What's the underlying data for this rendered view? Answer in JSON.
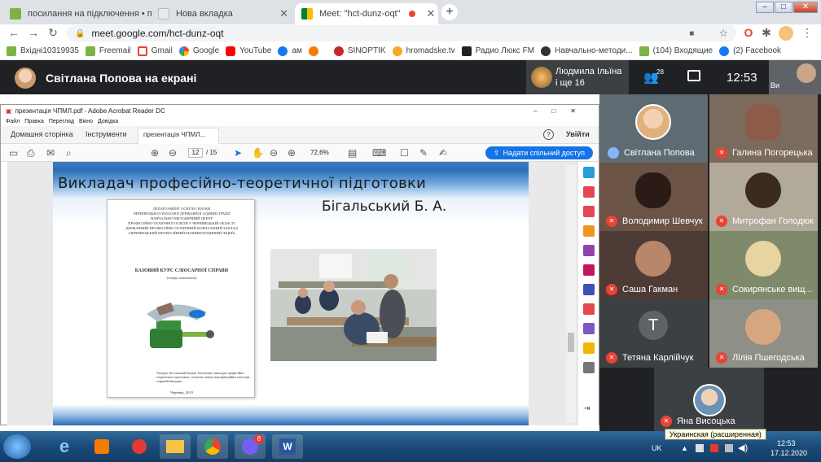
{
  "browser": {
    "tabs": [
      {
        "title": "посилання на підключення • по",
        "close": "✕"
      },
      {
        "title": "Нова вкладка",
        "close": "✕"
      },
      {
        "title": "Meet: \"hct-dunz-oqt\"",
        "close": "✕"
      }
    ],
    "new_tab": "+",
    "url": "meet.google.com/hct-dunz-oqt",
    "bookmarks": [
      "Вхідні10319935",
      "Freemail",
      "Gmail",
      "Google",
      "YouTube",
      "ам",
      "SINOPTIK",
      "hromadske.tv",
      "Радио Люкс FM",
      "Навчально-методи...",
      "(104) Входящие",
      "(2) Facebook"
    ],
    "profile_badge": "2"
  },
  "meet": {
    "presenter_label": "Світлана Попова на екрані",
    "pinned_name": "Людмила Ільїна",
    "pinned_more": "і ще 16",
    "participants_count": "28",
    "time": "12:53",
    "self_label": "Ви",
    "participants": [
      {
        "name": "Світлана Попова",
        "muted": false
      },
      {
        "name": "Галина Погорецька",
        "muted": true
      },
      {
        "name": "Володимир Шевчук",
        "muted": true
      },
      {
        "name": "Митрофан Голодюк",
        "muted": true
      },
      {
        "name": "Саша Гакман",
        "muted": true
      },
      {
        "name": "Сокирянське вищ...",
        "muted": true
      },
      {
        "name": "Тетяна Карлійчук",
        "muted": true,
        "initial": "T"
      },
      {
        "name": "Лілія Пшегодська",
        "muted": true
      },
      {
        "name": "Яна Висоцька",
        "muted": true
      }
    ]
  },
  "acrobat": {
    "window_title": "презентація ЧПМЛ.pdf - Adobe Acrobat Reader DC",
    "menu": [
      "Файл",
      "Правка",
      "Перегляд",
      "Вікно",
      "Довідка"
    ],
    "tabs": [
      "Домашня сторінка",
      "Інструменти",
      "презентація ЧПМЛ..."
    ],
    "login": "Увійти",
    "page_current": "12",
    "page_total": "/ 15",
    "zoom": "72,6%",
    "share": "Надати спільний доступ",
    "slide": {
      "title": "Викладач професійно-теоретичної підготовки",
      "name": "Бігальський Б. А.",
      "cover_header": [
        "ДЕПАРТАМЕНТ ОСВІТИ І НАУКИ",
        "ЧЕРНІВЕЦЬКОЇ ОБЛАСНОЇ ДЕРЖАВНОЇ АДМІНІСТРАЦІЇ",
        "НАВЧАЛЬНО-МЕТОДИЧНИЙ ЦЕНТР",
        "ПРОФЕСІЙНО-ТЕХНІЧНОЇ ОСВІТИ У ЧЕРНІВЕЦЬКІЙ ОБЛАСТІ",
        "ДЕРЖАВНИЙ ПРОФЕСІЙНО-ТЕХНІЧНИЙ НАВЧАЛЬНИЙ ЗАКЛАД",
        "«ЧЕРНІВЕЦЬКИЙ ПРОФЕСІЙНИЙ МАШИНОБУДІВНИЙ ЛІЦЕЙ»"
      ],
      "cover_course": "БАЗОВИЙ КУРС СЛЮСАРНОЇ СПРАВИ",
      "cover_sub": "(опорні конспекти)",
      "cover_author": "Укладач: Бігальський Богдан Антонович, викладач професійно-теоретичної підготовки, спеціаліст вищої кваліфікаційної категорії, старший викладач",
      "cover_city": "Чернівці, 2019"
    }
  },
  "taskbar": {
    "lang": "UK",
    "time": "12:53",
    "date": "17.12.2020",
    "tooltip": "Украинская (расширенная)",
    "viber_badge": "8"
  }
}
